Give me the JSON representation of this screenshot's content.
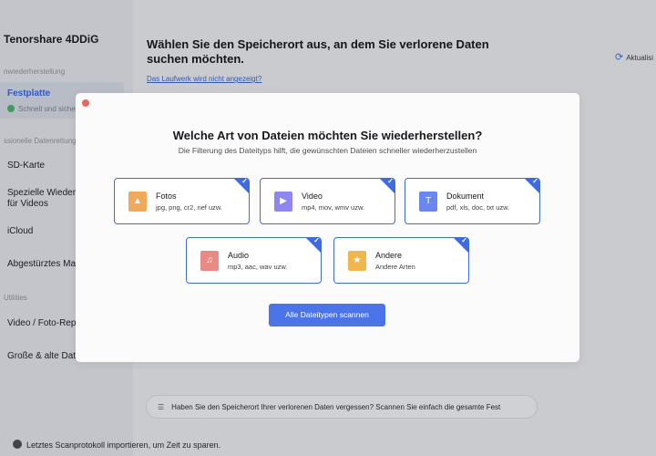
{
  "app": {
    "brand": "Tenorshare 4DDiG",
    "sidebar": {
      "section1": "nwiederherstellung",
      "active_item": "Festplatte",
      "active_sub": "Schnell und sicher",
      "section2": "ssionelle Datenrettung",
      "items": [
        "SD-Karte",
        "Spezielle Wiederh\nfür Videos",
        "iCloud",
        "Abgestürztes Mac"
      ],
      "section3": "Utilities",
      "utilities": [
        "Video / Foto-Repa",
        "Große & alte Date"
      ]
    },
    "main": {
      "title": "Wählen Sie den Speicherort aus, an dem Sie verlorene Daten suchen möchten.",
      "link": "Das Laufwerk wird nicht angezeigt?",
      "refresh": "Aktualisi",
      "hint": "Haben Sie den Speicherort Ihrer verlorenen Daten vergessen? Scannen Sie einfach die gesamte Fest",
      "history": "Letztes Scanprotokoll importieren, um Zeit zu sparen."
    }
  },
  "modal": {
    "title": "Welche Art von Dateien möchten Sie wiederherstellen?",
    "subtitle": "Die Filterung des Dateityps hilft, die gewünschten Dateien schneller wiederherzustellen",
    "cards": [
      {
        "name": "Fotos",
        "ext": "jpg, png, cr2, nef uzw.",
        "icon": "photo-icon",
        "color": "#f0a85a",
        "glyph": "▲",
        "checked": true
      },
      {
        "name": "Video",
        "ext": "mp4, mov, wmv uzw.",
        "icon": "video-icon",
        "color": "#8f86f2",
        "glyph": "▶",
        "checked": true
      },
      {
        "name": "Dokument",
        "ext": "pdf, xls, doc, txt uzw.",
        "icon": "document-icon",
        "color": "#6a86ef",
        "glyph": "T",
        "checked": true
      },
      {
        "name": "Audio",
        "ext": "mp3, aac, wav uzw.",
        "icon": "audio-icon",
        "color": "#e98a84",
        "glyph": "♫",
        "checked": true
      },
      {
        "name": "Andere",
        "ext": "Andere Arten",
        "icon": "other-file-icon",
        "color": "#f0b74f",
        "glyph": "★",
        "checked": true
      }
    ],
    "scan_button": "Alle Dateitypen scannen"
  },
  "colors": {
    "accent": "#4a74e8",
    "card_border": "#3f6be0",
    "close": "#f0625a"
  }
}
